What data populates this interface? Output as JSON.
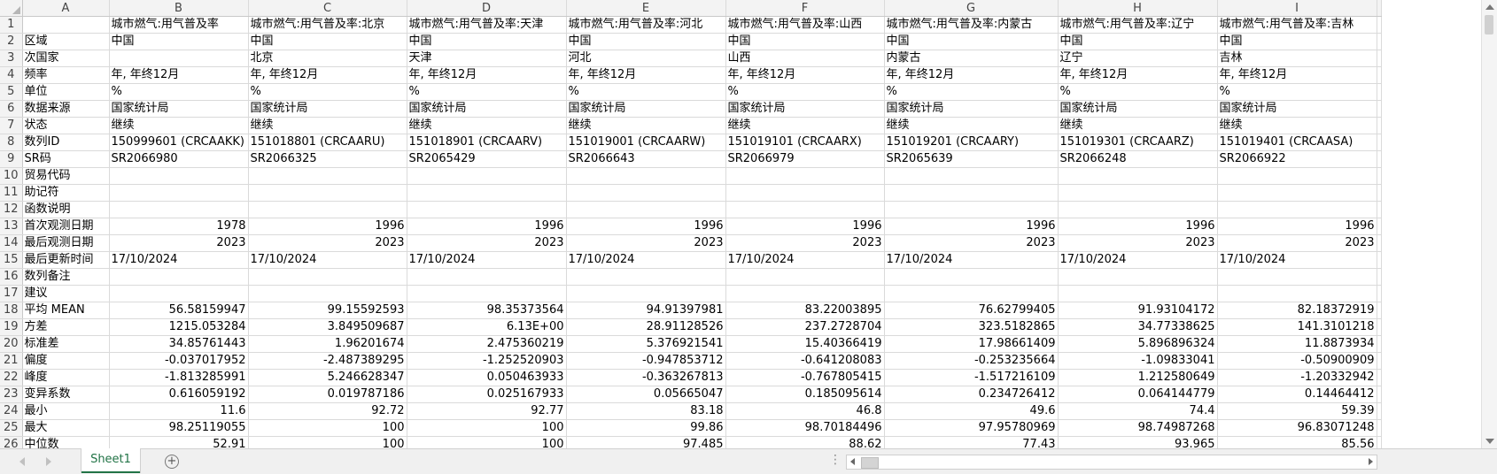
{
  "sheet": {
    "columns": [
      "A",
      "B",
      "C",
      "D",
      "E",
      "F",
      "G",
      "H",
      "I"
    ],
    "rows": [
      {
        "num": "1",
        "cells": [
          "",
          "城市燃气:用气普及率",
          "城市燃气:用气普及率:北京",
          "城市燃气:用气普及率:天津",
          "城市燃气:用气普及率:河北",
          "城市燃气:用气普及率:山西",
          "城市燃气:用气普及率:内蒙古",
          "城市燃气:用气普及率:辽宁",
          "城市燃气:用气普及率:吉林"
        ]
      },
      {
        "num": "2",
        "cells": [
          "区域",
          "中国",
          "中国",
          "中国",
          "中国",
          "中国",
          "中国",
          "中国",
          "中国"
        ]
      },
      {
        "num": "3",
        "cells": [
          "次国家",
          "",
          "北京",
          "天津",
          "河北",
          "山西",
          "内蒙古",
          "辽宁",
          "吉林"
        ]
      },
      {
        "num": "4",
        "cells": [
          "频率",
          "年, 年终12月",
          "年, 年终12月",
          "年, 年终12月",
          "年, 年终12月",
          "年, 年终12月",
          "年, 年终12月",
          "年, 年终12月",
          "年, 年终12月"
        ]
      },
      {
        "num": "5",
        "cells": [
          "单位",
          "%",
          "%",
          "%",
          "%",
          "%",
          "%",
          "%",
          "%"
        ]
      },
      {
        "num": "6",
        "cells": [
          "数据来源",
          "国家统计局",
          "国家统计局",
          "国家统计局",
          "国家统计局",
          "国家统计局",
          "国家统计局",
          "国家统计局",
          "国家统计局"
        ]
      },
      {
        "num": "7",
        "cells": [
          "状态",
          "继续",
          "继续",
          "继续",
          "继续",
          "继续",
          "继续",
          "继续",
          "继续"
        ]
      },
      {
        "num": "8",
        "cells": [
          "数列ID",
          "150999601 (CRCAAKK)",
          "151018801 (CRCAARU)",
          "151018901 (CRCAARV)",
          "151019001 (CRCAARW)",
          "151019101 (CRCAARX)",
          "151019201 (CRCAARY)",
          "151019301 (CRCAARZ)",
          "151019401 (CRCAASA)"
        ]
      },
      {
        "num": "9",
        "cells": [
          "SR码",
          "SR2066980",
          "SR2066325",
          "SR2065429",
          "SR2066643",
          "SR2066979",
          "SR2065639",
          "SR2066248",
          "SR2066922"
        ]
      },
      {
        "num": "10",
        "cells": [
          "贸易代码",
          "",
          "",
          "",
          "",
          "",
          "",
          "",
          ""
        ]
      },
      {
        "num": "11",
        "cells": [
          "助记符",
          "",
          "",
          "",
          "",
          "",
          "",
          "",
          ""
        ]
      },
      {
        "num": "12",
        "cells": [
          "函数说明",
          "",
          "",
          "",
          "",
          "",
          "",
          "",
          ""
        ]
      },
      {
        "num": "13",
        "cells": [
          "首次观测日期",
          "1978",
          "1996",
          "1996",
          "1996",
          "1996",
          "1996",
          "1996",
          "1996"
        ]
      },
      {
        "num": "14",
        "cells": [
          "最后观测日期",
          "2023",
          "2023",
          "2023",
          "2023",
          "2023",
          "2023",
          "2023",
          "2023"
        ]
      },
      {
        "num": "15",
        "cells": [
          "最后更新时间",
          "17/10/2024",
          "17/10/2024",
          "17/10/2024",
          "17/10/2024",
          "17/10/2024",
          "17/10/2024",
          "17/10/2024",
          "17/10/2024"
        ]
      },
      {
        "num": "16",
        "cells": [
          "数列备注",
          "",
          "",
          "",
          "",
          "",
          "",
          "",
          ""
        ]
      },
      {
        "num": "17",
        "cells": [
          "建议",
          "",
          "",
          "",
          "",
          "",
          "",
          "",
          ""
        ]
      },
      {
        "num": "18",
        "cells": [
          "平均 MEAN",
          "56.58159947",
          "99.15592593",
          "98.35373564",
          "94.91397981",
          "83.22003895",
          "76.62799405",
          "91.93104172",
          "82.18372919"
        ]
      },
      {
        "num": "19",
        "cells": [
          "方差",
          "1215.053284",
          "3.849509687",
          "6.13E+00",
          "28.91128526",
          "237.2728704",
          "323.5182865",
          "34.77338625",
          "141.3101218"
        ]
      },
      {
        "num": "20",
        "cells": [
          "标准差",
          "34.85761443",
          "1.96201674",
          "2.475360219",
          "5.376921541",
          "15.40366419",
          "17.98661409",
          "5.896896324",
          "11.8873934"
        ]
      },
      {
        "num": "21",
        "cells": [
          "偏度",
          "-0.037017952",
          "-2.487389295",
          "-1.252520903",
          "-0.947853712",
          "-0.641208083",
          "-0.253235664",
          "-1.09833041",
          "-0.50900909"
        ]
      },
      {
        "num": "22",
        "cells": [
          "峰度",
          "-1.813285991",
          "5.246628347",
          "0.050463933",
          "-0.363267813",
          "-0.767805415",
          "-1.517216109",
          "1.212580649",
          "-1.20332942"
        ]
      },
      {
        "num": "23",
        "cells": [
          "变异系数",
          "0.616059192",
          "0.019787186",
          "0.025167933",
          "0.05665047",
          "0.185095614",
          "0.234726412",
          "0.064144779",
          "0.14464412"
        ]
      },
      {
        "num": "24",
        "cells": [
          "最小",
          "11.6",
          "92.72",
          "92.77",
          "83.18",
          "46.8",
          "49.6",
          "74.4",
          "59.39"
        ]
      },
      {
        "num": "25",
        "cells": [
          "最大",
          "98.25119055",
          "100",
          "100",
          "99.86",
          "98.70184496",
          "97.95780969",
          "98.74987268",
          "96.83071248"
        ]
      },
      {
        "num": "26",
        "cells": [
          "中位数",
          "52.91",
          "100",
          "100",
          "97.485",
          "88.62",
          "77.43",
          "93.965",
          "85.56"
        ]
      }
    ],
    "numeric_from_row": 13,
    "numeric_text_rows": [
      15
    ]
  },
  "bottombar": {
    "sheet_tab": "Sheet1",
    "add_sheet_symbol": "+",
    "dots": "⋮"
  },
  "colors": {
    "accent": "#217346",
    "header_bg": "#f3f3f3",
    "gridline": "#dadada"
  }
}
